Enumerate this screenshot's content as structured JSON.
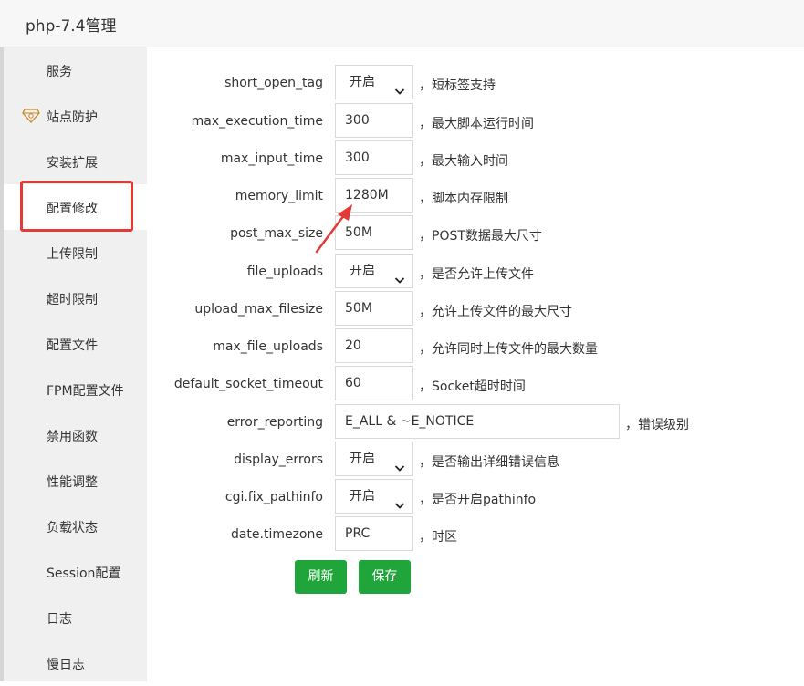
{
  "window": {
    "title": "php-7.4管理"
  },
  "sidebar": {
    "items": [
      {
        "label": "服务"
      },
      {
        "label": "站点防护",
        "icon": "diamond-shield-icon"
      },
      {
        "label": "安装扩展"
      },
      {
        "label": "配置修改",
        "active": true
      },
      {
        "label": "上传限制"
      },
      {
        "label": "超时限制"
      },
      {
        "label": "配置文件"
      },
      {
        "label": "FPM配置文件"
      },
      {
        "label": "禁用函数"
      },
      {
        "label": "性能调整"
      },
      {
        "label": "负载状态"
      },
      {
        "label": "Session配置"
      },
      {
        "label": "日志"
      },
      {
        "label": "慢日志"
      }
    ]
  },
  "settings": [
    {
      "name": "short_open_tag",
      "type": "select",
      "value": "开启",
      "desc": "，短标签支持"
    },
    {
      "name": "max_execution_time",
      "type": "input",
      "value": "300",
      "desc": "，最大脚本运行时间"
    },
    {
      "name": "max_input_time",
      "type": "input",
      "value": "300",
      "desc": "，最大输入时间"
    },
    {
      "name": "memory_limit",
      "type": "input",
      "value": "1280M",
      "desc": "，脚本内存限制"
    },
    {
      "name": "post_max_size",
      "type": "input",
      "value": "50M",
      "desc": "，POST数据最大尺寸"
    },
    {
      "name": "file_uploads",
      "type": "select",
      "value": "开启",
      "desc": "，是否允许上传文件"
    },
    {
      "name": "upload_max_filesize",
      "type": "input",
      "value": "50M",
      "desc": "，允许上传文件的最大尺寸"
    },
    {
      "name": "max_file_uploads",
      "type": "input",
      "value": "20",
      "desc": "，允许同时上传文件的最大数量"
    },
    {
      "name": "default_socket_timeout",
      "type": "input",
      "value": "60",
      "desc": "，Socket超时时间"
    },
    {
      "name": "error_reporting",
      "type": "input",
      "value": "E_ALL & ~E_NOTICE",
      "desc": "，错误级别"
    },
    {
      "name": "display_errors",
      "type": "select",
      "value": "开启",
      "desc": "，是否输出详细错误信息"
    },
    {
      "name": "cgi.fix_pathinfo",
      "type": "select",
      "value": "开启",
      "desc": "，是否开启pathinfo"
    },
    {
      "name": "date.timezone",
      "type": "input",
      "value": "PRC",
      "desc": "，时区"
    }
  ],
  "buttons": {
    "refresh": "刷新",
    "save": "保存"
  },
  "colors": {
    "accent": "#20a53a",
    "highlight": "#e53935",
    "sidebar_bg": "#f0f0f0"
  }
}
